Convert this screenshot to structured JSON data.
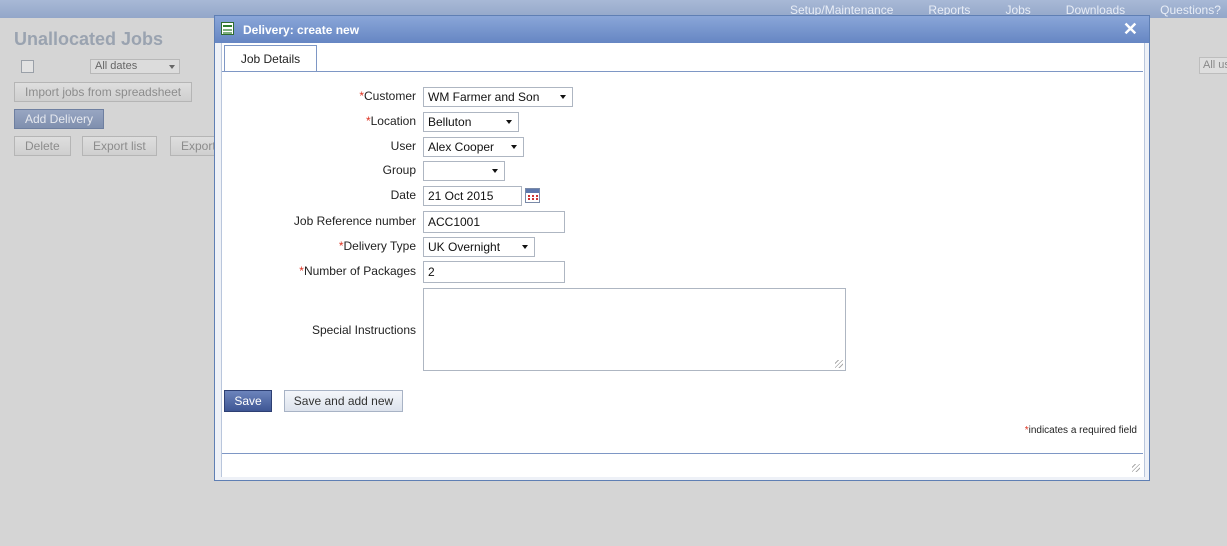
{
  "topnav": [
    "Setup/Maintenance",
    "Reports",
    "Jobs",
    "Downloads",
    "Questions?"
  ],
  "page": {
    "title": "Unallocated Jobs",
    "date_filter": "All dates",
    "right_filter": "All us",
    "buttons": {
      "import": "Import jobs from spreadsheet",
      "add_delivery": "Add Delivery",
      "delete": "Delete",
      "export_list": "Export list",
      "export": "Export"
    }
  },
  "dialog": {
    "title": "Delivery: create new",
    "close_glyph": "✕",
    "tab": "Job Details",
    "required_mark": "*",
    "fields": {
      "customer": {
        "label": "Customer",
        "value": "WM Farmer and Son"
      },
      "location": {
        "label": "Location",
        "value": "Belluton"
      },
      "user": {
        "label": "User",
        "value": "Alex Cooper"
      },
      "group": {
        "label": "Group",
        "value": ""
      },
      "date": {
        "label": "Date",
        "value": "21 Oct 2015"
      },
      "job_reference": {
        "label": "Job Reference number",
        "value": "ACC1001"
      },
      "delivery_type": {
        "label": "Delivery Type",
        "value": "UK Overnight"
      },
      "packages": {
        "label": "Number of Packages",
        "value": "2"
      },
      "special_instructions": {
        "label": "Special Instructions",
        "value": ""
      }
    },
    "save": "Save",
    "save_and_add_new": "Save and add new",
    "required_note": "indicates a required field"
  }
}
